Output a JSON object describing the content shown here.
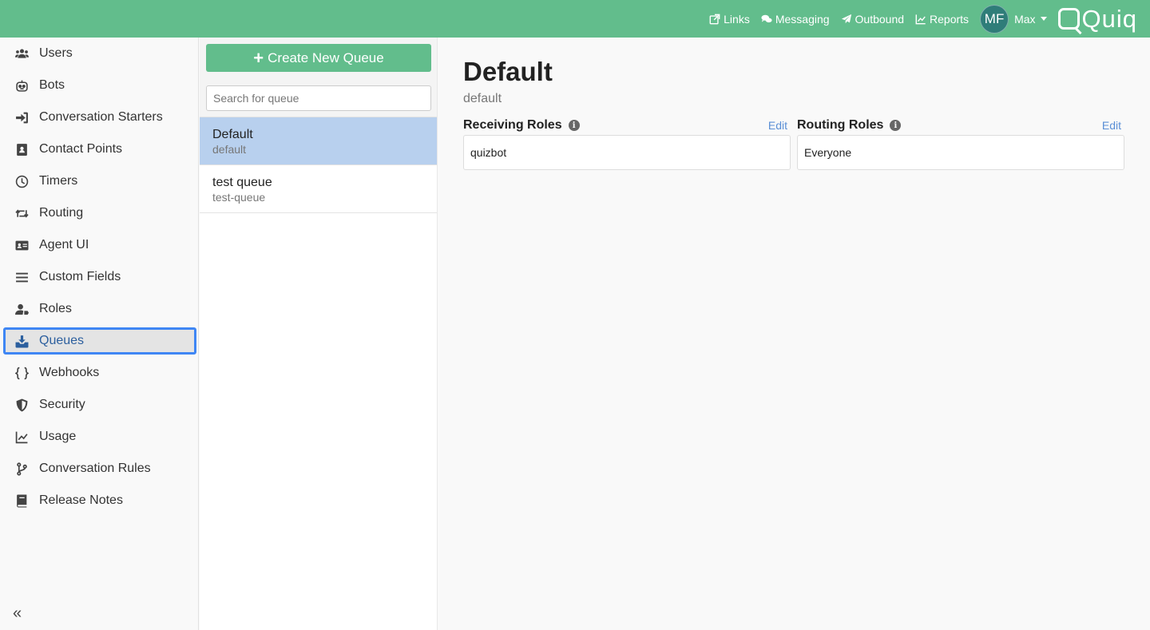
{
  "topnav": {
    "links": "Links",
    "messaging": "Messaging",
    "outbound": "Outbound",
    "reports": "Reports",
    "avatar_initials": "MF",
    "user_name": "Max",
    "logo_text": "Quiq"
  },
  "sidebar": {
    "items": [
      {
        "label": "Users",
        "icon": "users-icon"
      },
      {
        "label": "Bots",
        "icon": "robot-icon"
      },
      {
        "label": "Conversation Starters",
        "icon": "sign-in-icon"
      },
      {
        "label": "Contact Points",
        "icon": "address-book-icon"
      },
      {
        "label": "Timers",
        "icon": "clock-icon"
      },
      {
        "label": "Routing",
        "icon": "retweet-icon"
      },
      {
        "label": "Agent UI",
        "icon": "id-card-icon"
      },
      {
        "label": "Custom Fields",
        "icon": "bars-icon"
      },
      {
        "label": "Roles",
        "icon": "user-tag-icon"
      },
      {
        "label": "Queues",
        "icon": "inbox-download-icon",
        "active": true
      },
      {
        "label": "Webhooks",
        "icon": "braces-icon"
      },
      {
        "label": "Security",
        "icon": "shield-icon"
      },
      {
        "label": "Usage",
        "icon": "line-chart-icon"
      },
      {
        "label": "Conversation Rules",
        "icon": "code-branch-icon"
      },
      {
        "label": "Release Notes",
        "icon": "book-icon"
      }
    ],
    "collapse_icon": "double-chevron-left-icon"
  },
  "queues": {
    "create_label": "Create New Queue",
    "search_placeholder": "Search for queue",
    "items": [
      {
        "name": "Default",
        "id": "default",
        "active": true
      },
      {
        "name": "test queue",
        "id": "test-queue"
      }
    ]
  },
  "detail": {
    "title": "Default",
    "subtitle": "default",
    "receiving_label": "Receiving Roles",
    "receiving_value": "quizbot",
    "routing_label": "Routing Roles",
    "routing_value": "Everyone",
    "edit_label": "Edit"
  },
  "colors": {
    "topbar": "#62bd8c",
    "active_queue": "#b8d0ee",
    "active_nav_border": "#3f86f4",
    "link": "#5a8fd6"
  }
}
